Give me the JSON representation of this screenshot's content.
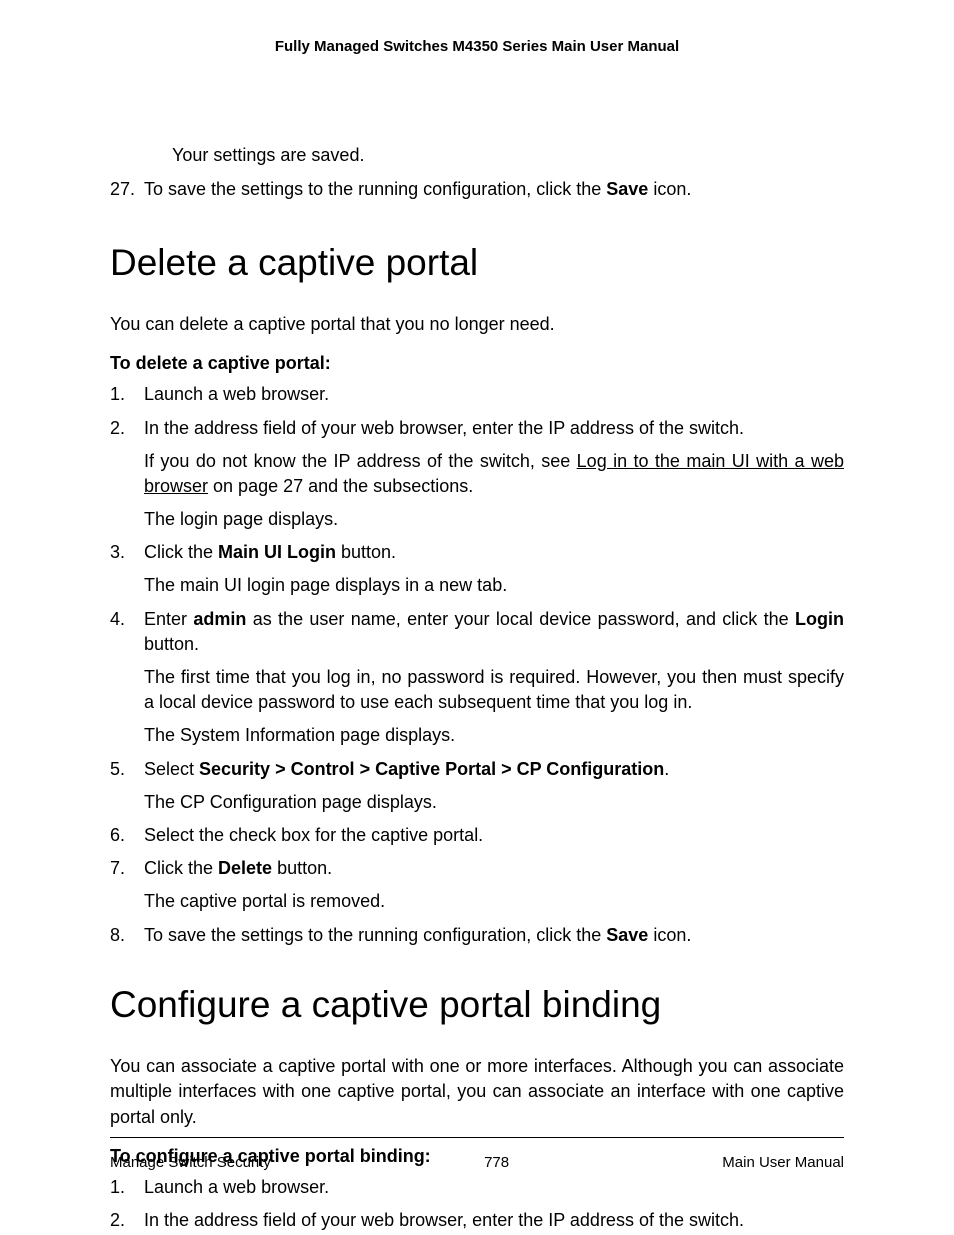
{
  "header": {
    "title": "Fully Managed Switches M4350 Series Main User Manual"
  },
  "carryover": {
    "saved_text": "Your settings are saved.",
    "step27_num": "27.",
    "step27_pre": "To save the settings to the running configuration, click the ",
    "step27_bold": "Save",
    "step27_post": " icon."
  },
  "section1": {
    "heading": "Delete a captive portal",
    "intro": "You can delete a captive portal that you no longer need.",
    "subhead": "To delete a captive portal:",
    "steps": {
      "s1": "Launch a web browser.",
      "s2": "In the address field of your web browser, enter the IP address of the switch.",
      "s2_sub_a_pre": "If you do not know the IP address of the switch, see ",
      "s2_sub_a_link": "Log in to the main UI with a web browser",
      "s2_sub_a_post": " on page 27 and the subsections.",
      "s2_sub_b": "The login page displays.",
      "s3_pre": "Click the ",
      "s3_bold": "Main UI Login",
      "s3_post": " button.",
      "s3_sub": "The main UI login page displays in a new tab.",
      "s4_pre": "Enter ",
      "s4_b1": "admin",
      "s4_mid": " as the user name, enter your local device password, and click the ",
      "s4_b2": "Login",
      "s4_post": " button.",
      "s4_sub_a": "The first time that you log in, no password is required. However, you then must specify a local device password to use each subsequent time that you log in.",
      "s4_sub_b": "The System Information page displays.",
      "s5_pre": "Select ",
      "s5_bold": "Security > Control > Captive Portal > CP Configuration",
      "s5_post": ".",
      "s5_sub": "The CP Configuration page displays.",
      "s6": "Select the check box for the captive portal.",
      "s7_pre": "Click the ",
      "s7_bold": "Delete",
      "s7_post": " button.",
      "s7_sub": "The captive portal is removed.",
      "s8_pre": "To save the settings to the running configuration, click the ",
      "s8_bold": "Save",
      "s8_post": " icon."
    }
  },
  "section2": {
    "heading": "Configure a captive portal binding",
    "intro": "You can associate a captive portal with one or more interfaces. Although you can associate multiple interfaces with one captive portal, you can associate an interface with one captive portal only.",
    "subhead": "To configure a captive portal binding:",
    "steps": {
      "s1": "Launch a web browser.",
      "s2": "In the address field of your web browser, enter the IP address of the switch."
    }
  },
  "footer": {
    "left": "Manage Switch Security",
    "center": "778",
    "right": "Main User Manual"
  }
}
